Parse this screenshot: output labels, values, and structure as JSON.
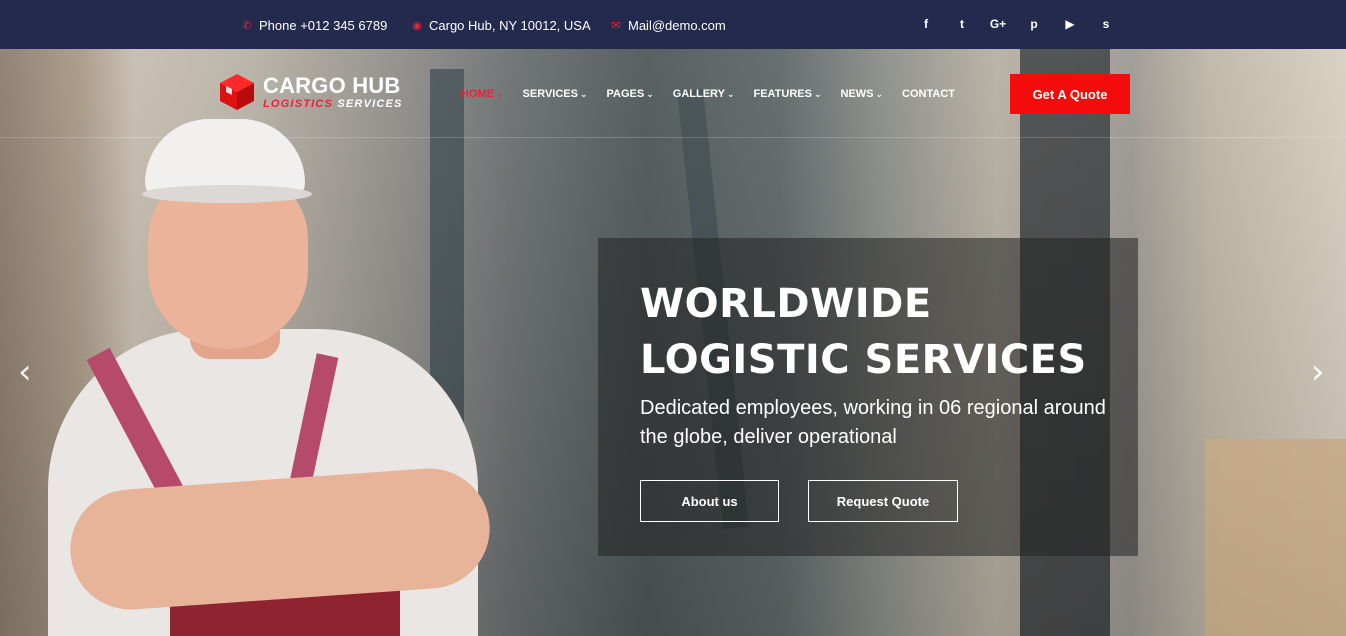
{
  "topbar": {
    "phone": "Phone +012 345 6789",
    "address": "Cargo Hub, NY 10012, USA",
    "email": "Mail@demo.com",
    "social": [
      {
        "icon": "facebook-icon",
        "glyph": "f"
      },
      {
        "icon": "twitter-icon",
        "glyph": "t"
      },
      {
        "icon": "google-plus-icon",
        "glyph": "G+"
      },
      {
        "icon": "pinterest-icon",
        "glyph": "p"
      },
      {
        "icon": "youtube-icon",
        "glyph": "▶"
      },
      {
        "icon": "skype-icon",
        "glyph": "s"
      }
    ]
  },
  "logo": {
    "brand": "CARGO HUB",
    "tag_red": "LOGISTICS",
    "tag_white": "SERVICES"
  },
  "nav": {
    "items": [
      {
        "label": "HOME",
        "chev": "⌄"
      },
      {
        "label": "SERVICES",
        "chev": "⌄"
      },
      {
        "label": "PAGES",
        "chev": "⌄"
      },
      {
        "label": "GALLERY",
        "chev": "⌄"
      },
      {
        "label": "FEATURES",
        "chev": "⌄"
      },
      {
        "label": "NEWS",
        "chev": "⌄"
      },
      {
        "label": "CONTACT",
        "chev": ""
      }
    ],
    "cta": "Get A Quote"
  },
  "slide": {
    "title_line1": "WORLDWIDE",
    "title_line2": "LOGISTIC SERVICES",
    "description": "Dedicated employees, working in 06 regional around the globe, deliver operational",
    "btn_about": "About us",
    "btn_request": "Request Quote",
    "prev_arrow": "‹",
    "next_arrow": "›"
  },
  "colors": {
    "topbar_bg": "#232a4e",
    "accent_red": "#f40c0c",
    "active_nav": "#e8233a"
  }
}
